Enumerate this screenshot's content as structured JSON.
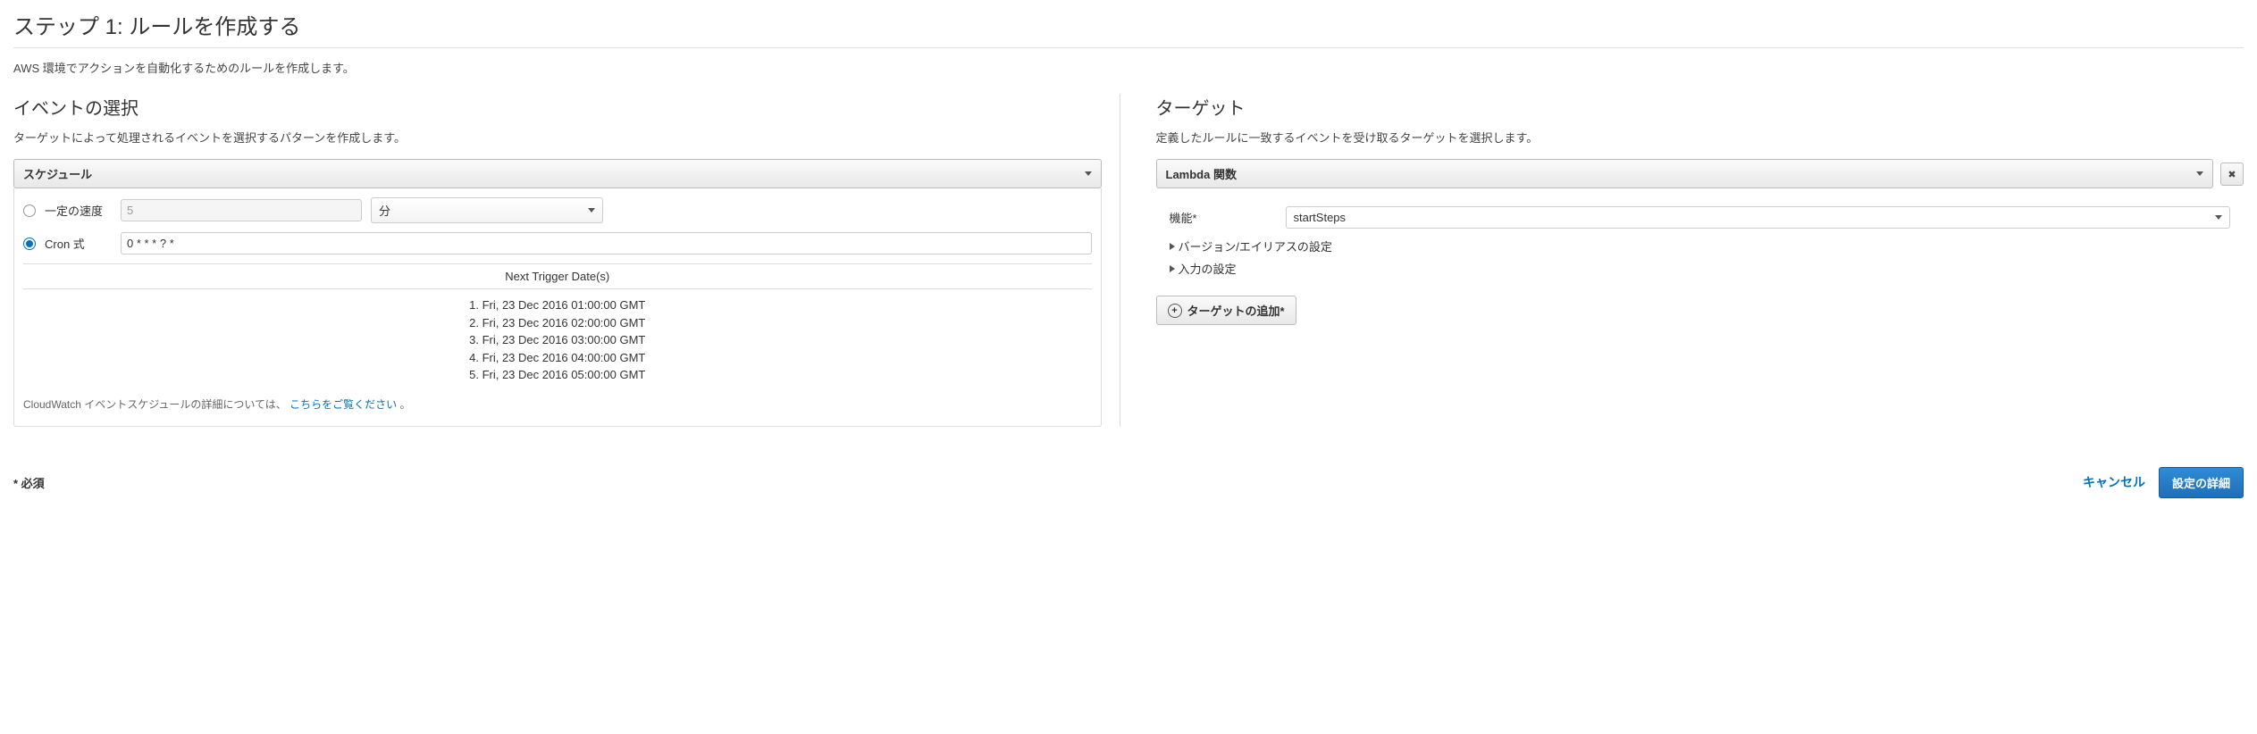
{
  "header": {
    "title": "ステップ 1: ルールを作成する",
    "description": "AWS 環境でアクションを自動化するためのルールを作成します。"
  },
  "event": {
    "title": "イベントの選択",
    "description": "ターゲットによって処理されるイベントを選択するパターンを作成します。",
    "source_dropdown": "スケジュール",
    "rate_label": "一定の速度",
    "rate_value": "5",
    "rate_unit": "分",
    "cron_label": "Cron 式",
    "cron_value": "0 * * * ? *",
    "trigger_header": "Next Trigger Date(s)",
    "triggers": [
      "1. Fri, 23 Dec 2016 01:00:00 GMT",
      "2. Fri, 23 Dec 2016 02:00:00 GMT",
      "3. Fri, 23 Dec 2016 03:00:00 GMT",
      "4. Fri, 23 Dec 2016 04:00:00 GMT",
      "5. Fri, 23 Dec 2016 05:00:00 GMT"
    ],
    "helper_prefix": "CloudWatch イベントスケジュールの詳細については、",
    "helper_link": "こちらをご覧ください",
    "helper_suffix": " 。"
  },
  "target": {
    "title": "ターゲット",
    "description": "定義したルールに一致するイベントを受け取るターゲットを選択します。",
    "type_dropdown": "Lambda 関数",
    "function_label": "機能*",
    "function_value": "startSteps",
    "expand_version": "バージョン/エイリアスの設定",
    "expand_input": "入力の設定",
    "add_button": "ターゲットの追加*"
  },
  "footer": {
    "required": "* 必須",
    "cancel": "キャンセル",
    "submit": "設定の詳細"
  }
}
